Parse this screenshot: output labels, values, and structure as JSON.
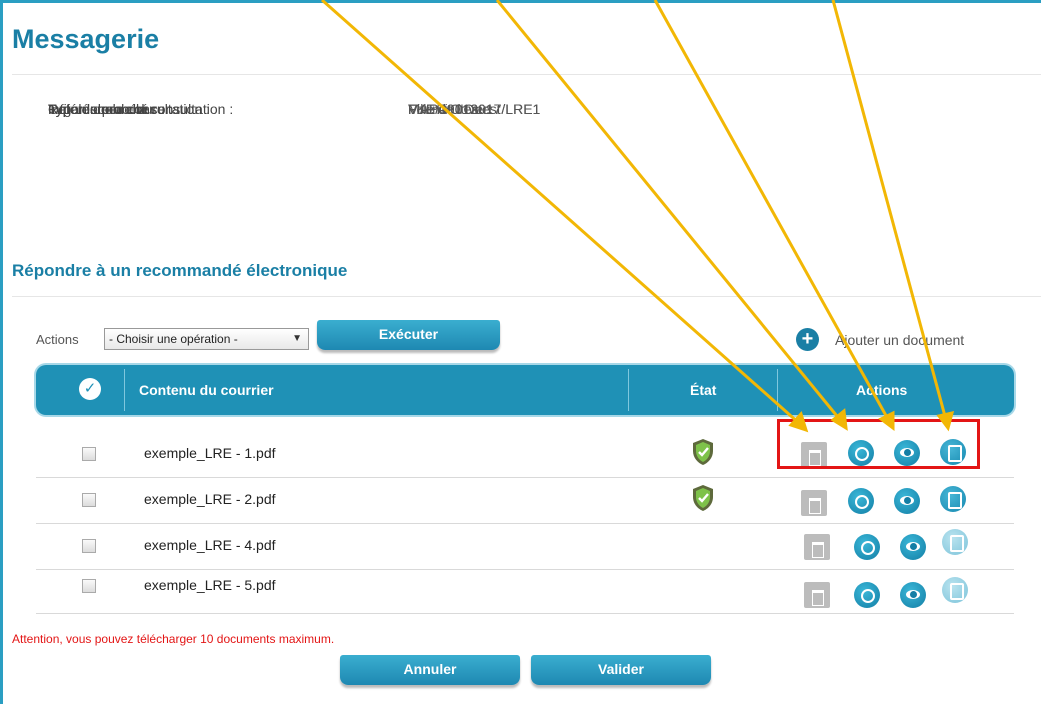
{
  "page": {
    "title": "Messagerie"
  },
  "consultation": {
    "rows": [
      {
        "label": "Organisme :",
        "value": "Ville de l'Ouest"
      },
      {
        "label": "Type de procédure :",
        "value": "MAPA Ouvert"
      },
      {
        "label": "Intitulé de la consultation :",
        "value": "FKE/09012017/LRE1"
      },
      {
        "label": "Référence de la consultation :",
        "value": "FKE/09012017/LRE1"
      },
      {
        "label": "Type de marché :",
        "value": "Fournitures"
      }
    ]
  },
  "section": {
    "title": "Répondre à un recommandé électronique"
  },
  "toolbar": {
    "actions_label": "Actions",
    "select_value": "- Choisir une opération -",
    "execute_label": "Exécuter",
    "add_document_label": "Ajouter un document"
  },
  "table": {
    "headers": {
      "content": "Contenu du courrier",
      "state": "État",
      "actions": "Actions"
    },
    "rows": [
      {
        "file": "exemple_LRE - 1.pdf",
        "state_icon": "shield-check-icon",
        "send_active": true
      },
      {
        "file": "exemple_LRE - 2.pdf",
        "state_icon": "shield-check-icon",
        "send_active": true
      },
      {
        "file": "exemple_LRE - 4.pdf",
        "state_icon": "",
        "send_active": false
      },
      {
        "file": "exemple_LRE - 5.pdf",
        "state_icon": "",
        "send_active": false
      }
    ]
  },
  "footer": {
    "warning": "Attention, vous pouvez télécharger 10 documents maximum.",
    "cancel_label": "Annuler",
    "validate_label": "Valider"
  },
  "colors": {
    "accent": "#1f91b6",
    "title": "#1a7fa5",
    "warning": "#e31515",
    "annotation_arrow": "#f2b705"
  }
}
